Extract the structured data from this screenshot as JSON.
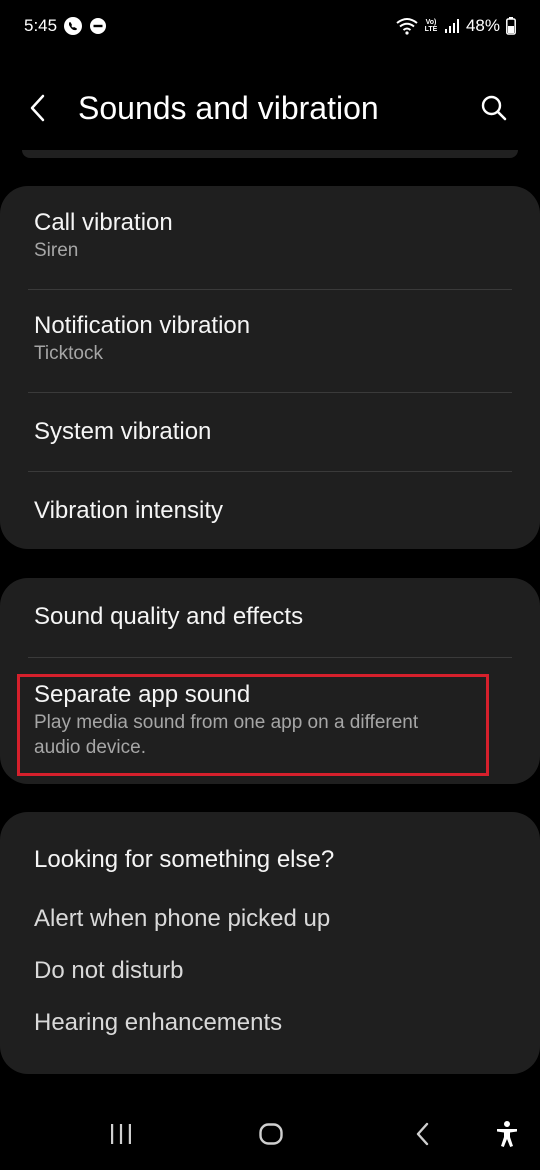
{
  "status_bar": {
    "time": "5:45",
    "lte_label_top": "Vo)",
    "lte_label_bottom": "LTE",
    "battery": "48%"
  },
  "header": {
    "title": "Sounds and vibration",
    "back_icon": "chevron-left-icon",
    "search_icon": "search-icon"
  },
  "vibration_card": {
    "items": [
      {
        "title": "Call vibration",
        "subtitle": "Siren"
      },
      {
        "title": "Notification vibration",
        "subtitle": "Ticktock"
      },
      {
        "title": "System vibration"
      },
      {
        "title": "Vibration intensity"
      }
    ]
  },
  "sound_card": {
    "items": [
      {
        "title": "Sound quality and effects"
      },
      {
        "title": "Separate app sound",
        "subtitle_line1": "Play media sound from one app on a different",
        "subtitle_line2": "audio device."
      }
    ]
  },
  "suggestions": {
    "heading": "Looking for something else?",
    "links": [
      "Alert when phone picked up",
      "Do not disturb",
      "Hearing enhancements"
    ]
  },
  "nav_bar": {
    "icons": [
      "recent-apps-icon",
      "home-icon",
      "back-icon",
      "accessibility-icon"
    ]
  },
  "colors": {
    "background": "#000000",
    "card": "#1f1f1f",
    "highlight": "#d6202c",
    "subtitle": "#a6a6a6"
  }
}
